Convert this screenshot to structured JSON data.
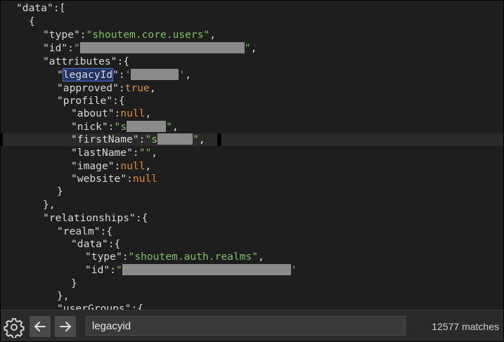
{
  "code": {
    "lines": [
      {
        "key": "data",
        "open": "["
      },
      {
        "open": "{"
      },
      {
        "key": "type",
        "str": "shoutem.core.users"
      },
      {
        "key": "id",
        "redacted": true
      },
      {
        "key": "attributes",
        "open": "{"
      },
      {
        "key": "legacyId",
        "redacted": true,
        "highlighted": true
      },
      {
        "key": "approved",
        "literal": "true"
      },
      {
        "key": "profile",
        "open": "{"
      },
      {
        "key": "about",
        "literal": "null"
      },
      {
        "key": "nick",
        "str_prefix": "s",
        "redacted": true
      },
      {
        "key": "firstName",
        "str_prefix": "s",
        "redacted": true,
        "current": true
      },
      {
        "key": "lastName",
        "str": ""
      },
      {
        "key": "image",
        "literal": "null"
      },
      {
        "key": "website",
        "literal": "null"
      },
      {
        "close": "}"
      },
      {
        "close": "},"
      },
      {
        "key": "relationships",
        "open": "{"
      },
      {
        "key": "realm",
        "open": "{"
      },
      {
        "key": "data",
        "open": "{"
      },
      {
        "key": "type",
        "str": "shoutem.auth.realms"
      },
      {
        "key": "id",
        "redacted": true
      },
      {
        "close": "}"
      },
      {
        "close": "},"
      },
      {
        "key": "userGroups",
        "open": "{"
      }
    ]
  },
  "findbar": {
    "query": "legacyid",
    "match_count": "12577 matches",
    "icons": {
      "settings": "gear-icon",
      "previous": "arrow-left-icon",
      "next": "arrow-right-icon"
    }
  },
  "colors": {
    "background": "#1e1e1e",
    "key": "#d9d9d9",
    "string": "#7ec161",
    "literal": "#e08c2a",
    "redaction": "#8a8a8a"
  }
}
